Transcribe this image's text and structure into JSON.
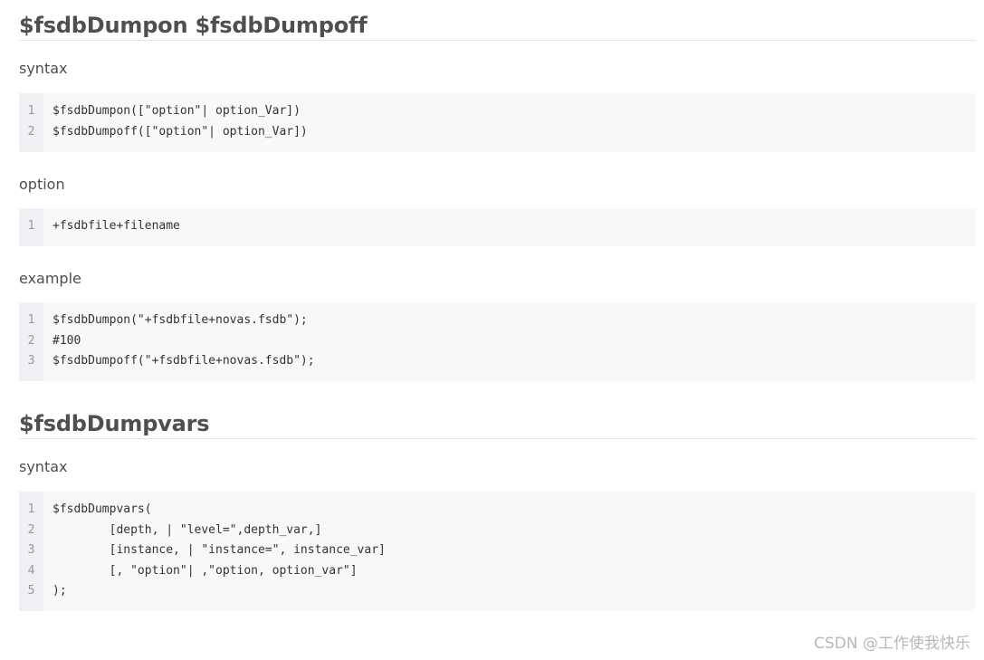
{
  "sections": [
    {
      "heading": "$fsdbDumpon $fsdbDumpoff",
      "blocks": [
        {
          "label": "syntax",
          "code": [
            "$fsdbDumpon([\"option\"| option_Var])",
            "$fsdbDumpoff([\"option\"| option_Var])"
          ]
        },
        {
          "label": "option",
          "code": [
            "+fsdbfile+filename"
          ]
        },
        {
          "label": "example",
          "code": [
            "$fsdbDumpon(\"+fsdbfile+novas.fsdb\");",
            "#100",
            "$fsdbDumpoff(\"+fsdbfile+novas.fsdb\");"
          ]
        }
      ]
    },
    {
      "heading": "$fsdbDumpvars",
      "blocks": [
        {
          "label": "syntax",
          "code": [
            "$fsdbDumpvars(",
            "        [depth, | \"level=\",depth_var,]",
            "        [instance, | \"instance=\", instance_var]",
            "        [, \"option\"| ,\"option, option_var\"]",
            ");"
          ]
        }
      ]
    }
  ],
  "watermark": "CSDN @工作使我快乐"
}
